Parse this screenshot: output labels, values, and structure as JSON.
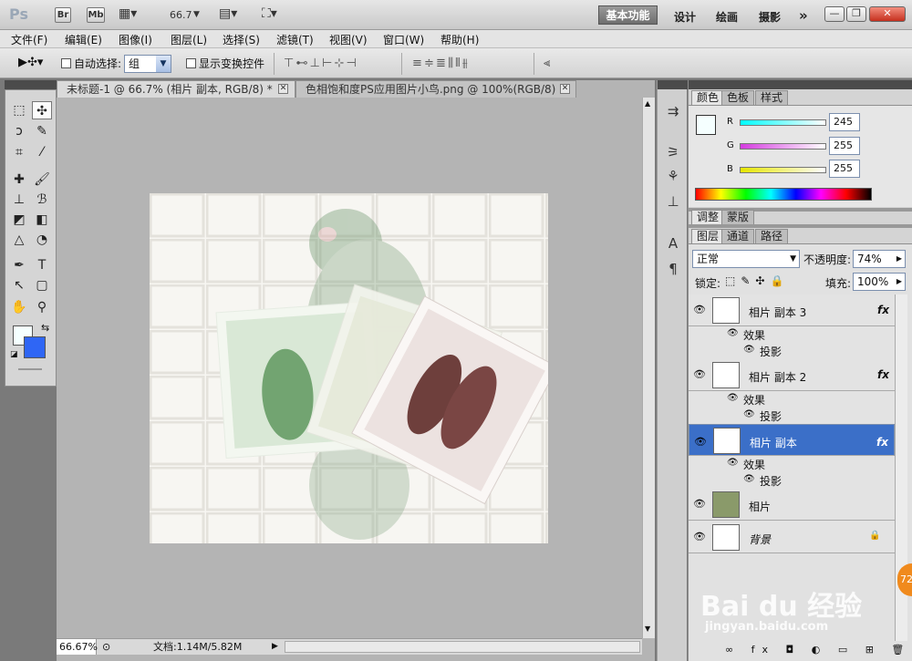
{
  "appbar": {
    "logo": "Ps",
    "bridge": "Br",
    "minibridge": "Mb",
    "zoom": "66.7",
    "workspaces": [
      "基本功能",
      "设计",
      "绘画",
      "摄影"
    ],
    "more": "»",
    "win_min": "—",
    "win_max": "❐",
    "win_close": "✕"
  },
  "menu": [
    "文件(F)",
    "编辑(E)",
    "图像(I)",
    "图层(L)",
    "选择(S)",
    "滤镜(T)",
    "视图(V)",
    "窗口(W)",
    "帮助(H)"
  ],
  "options": {
    "auto_select_label": "自动选择:",
    "auto_select_value": "组",
    "show_transform_label": "显示变换控件"
  },
  "tabs": [
    {
      "label": "未标题-1 @ 66.7% (相片 副本, RGB/8) *"
    },
    {
      "label": "色相饱和度PS应用图片小鸟.png @ 100%(RGB/8)"
    }
  ],
  "status": {
    "zoom": "66.67%",
    "doc": "文档:1.14M/5.82M"
  },
  "color_panel": {
    "tabs": [
      "颜色",
      "色板",
      "样式"
    ],
    "r_label": "R",
    "g_label": "G",
    "b_label": "B",
    "r": "245",
    "g": "255",
    "b": "255",
    "fg_color": "#f5ffff",
    "bg_color": "#2f66f5"
  },
  "adjust_panel": {
    "tabs": [
      "调整",
      "蒙版"
    ]
  },
  "layers_panel": {
    "tabs": [
      "图层",
      "通道",
      "路径"
    ],
    "blend_mode": "正常",
    "opacity_label": "不透明度:",
    "opacity": "74%",
    "lock_label": "锁定:",
    "fill_label": "填充:",
    "fill": "100%",
    "layers": [
      {
        "name": "相片 副本 3",
        "effects_label": "效果",
        "effect": "投影",
        "fx": "fx"
      },
      {
        "name": "相片 副本 2",
        "effects_label": "效果",
        "effect": "投影",
        "fx": "fx"
      },
      {
        "name": "相片 副本",
        "effects_label": "效果",
        "effect": "投影",
        "fx": "fx"
      },
      {
        "name": "相片"
      },
      {
        "name": "背景"
      }
    ]
  },
  "watermark": {
    "brand": "Bai du 经验",
    "url": "jingyan.baidu.com",
    "badge": "72"
  }
}
